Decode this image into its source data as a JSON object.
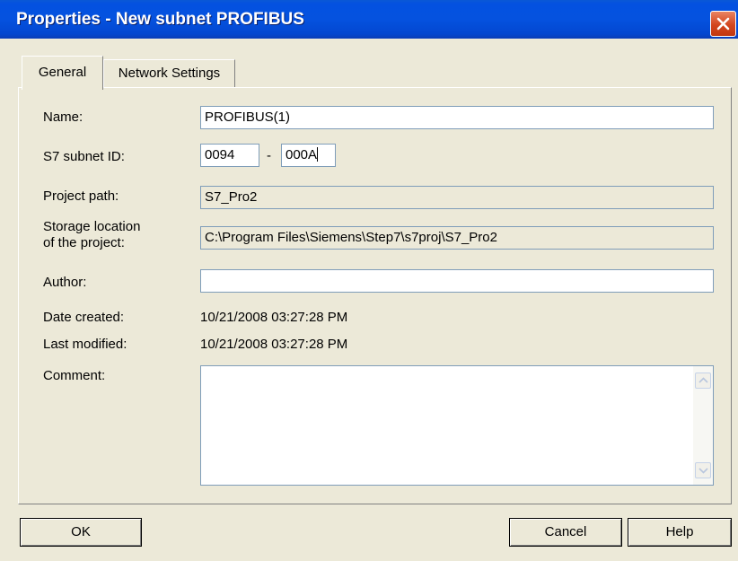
{
  "window": {
    "title": "Properties - New subnet PROFIBUS",
    "close_icon": "close-icon"
  },
  "tabs": [
    {
      "label": "General",
      "active": true
    },
    {
      "label": "Network Settings",
      "active": false
    }
  ],
  "form": {
    "name_label": "Name:",
    "name_value": "PROFIBUS(1)",
    "subnet_id_label": "S7 subnet ID:",
    "subnet_id_part1": "0094",
    "subnet_id_separator": "-",
    "subnet_id_part2": "000A",
    "project_path_label": "Project path:",
    "project_path_value": "S7_Pro2",
    "storage_label_line1": "Storage location",
    "storage_label_line2": "of the project:",
    "storage_value": "C:\\Program Files\\Siemens\\Step7\\s7proj\\S7_Pro2",
    "author_label": "Author:",
    "author_value": "",
    "date_created_label": "Date created:",
    "date_created_value": "10/21/2008 03:27:28 PM",
    "last_modified_label": "Last modified:",
    "last_modified_value": "10/21/2008 03:27:28 PM",
    "comment_label": "Comment:",
    "comment_value": ""
  },
  "buttons": {
    "ok": "OK",
    "cancel": "Cancel",
    "help": "Help"
  },
  "colors": {
    "title_bar": "#0552df",
    "dialog_bg": "#ece9d8",
    "close_button": "#d3461f"
  }
}
